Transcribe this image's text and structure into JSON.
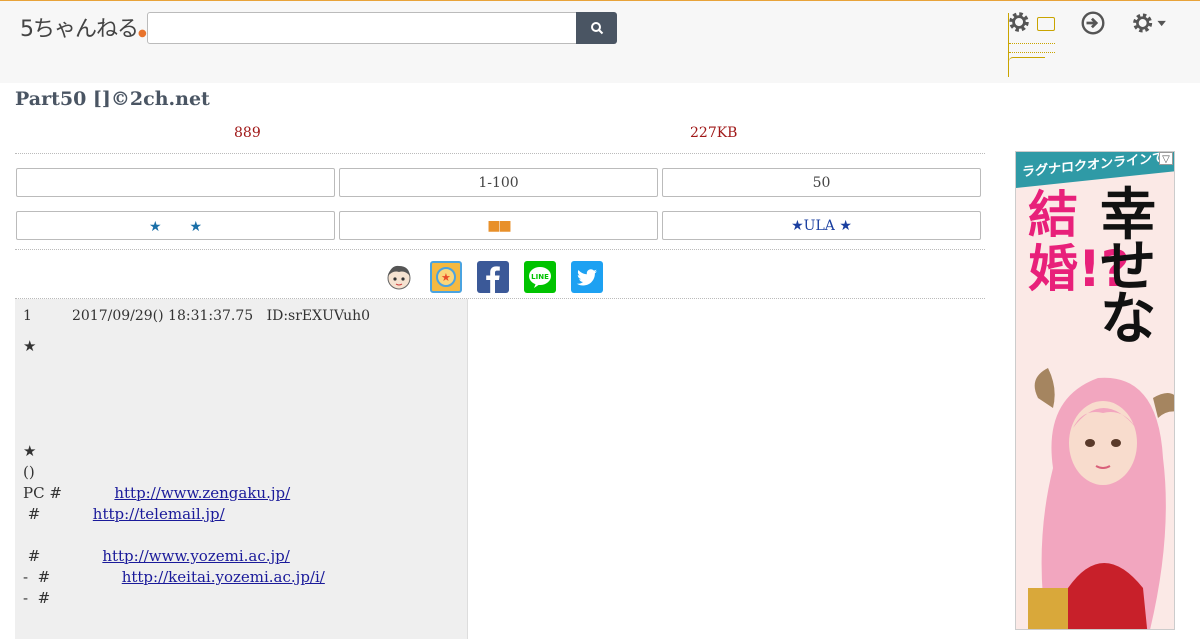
{
  "header": {
    "logo_text": "5ちゃんねる",
    "search": {
      "value": "",
      "placeholder": ""
    },
    "search_button_icon": "search-icon",
    "icons": [
      "gear-icon",
      "sign-in-icon",
      "gear-dropdown-icon"
    ]
  },
  "thread": {
    "title": "Part50 []©2ch.net",
    "post_count": "889",
    "size": "227KB"
  },
  "nav_row1": {
    "left": "",
    "middle": "1-100",
    "right": "50"
  },
  "nav_row2": {
    "left": "★　　★",
    "middle": "■■",
    "right": "★ULA ★"
  },
  "share_icons": [
    "avatar-icon",
    "app-icon",
    "facebook-icon",
    "line-icon",
    "twitter-icon"
  ],
  "post": {
    "number": "1",
    "date": "2017/09/29() 18:31:37.75",
    "id": "ID:srEXUVuh0",
    "star_top": "★",
    "star_mid": "★",
    "paren": "()",
    "line_pc_prefix": "PC #           ",
    "link1": "http://www.zengaku.jp/",
    "line2_prefix": " #           ",
    "link2": "http://telemail.jp/",
    "line4_prefix": " #             ",
    "link3": "http://www.yozemi.ac.jp/",
    "line5_prefix": "-  #               ",
    "link4": "http://keitai.yozemi.ac.jp/i/",
    "line6": "-  #"
  },
  "ad": {
    "banner": "ラグナロクオンラインで",
    "pink_text": "結婚!?",
    "black_text": "幸せな",
    "close_label": "▽"
  }
}
